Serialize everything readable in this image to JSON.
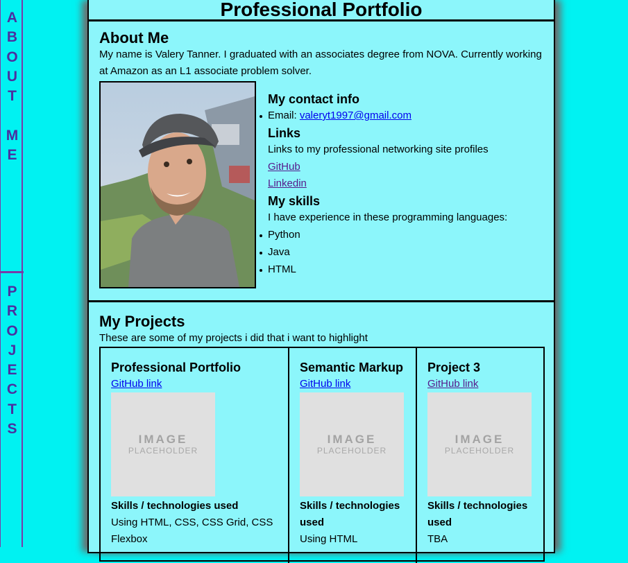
{
  "colors": {
    "background": "#00f2f2",
    "panel": "#8cf6fb",
    "nav_text": "#4b2fa0",
    "nav_border": "#7a3aa8",
    "link": "#0000ee",
    "visited_link": "#551a8b"
  },
  "sidenav": {
    "about_letters": [
      "A",
      "B",
      "O",
      "U",
      "T",
      "",
      "M",
      "E"
    ],
    "projects_letters": [
      "P",
      "R",
      "O",
      "J",
      "E",
      "C",
      "T",
      "S"
    ]
  },
  "site_title": "Professional Portfolio",
  "about": {
    "heading": "About Me",
    "text": "My name is Valery Tanner. I graduated with an associates degree from NOVA. Currently working at Amazon as an L1 associate problem solver.",
    "contact_heading": "My contact info",
    "email_label": "Email: ",
    "email": "valeryt1997@gmail.com",
    "links_heading": "Links",
    "links_intro": "Links to my professional networking site profiles",
    "github_link": "GitHub",
    "linkedin_link": "Linkedin",
    "skills_heading": "My skills",
    "skills_intro": "I have experience in these programming languages:",
    "skills": [
      "Python",
      "Java",
      "HTML"
    ]
  },
  "projects": {
    "heading": "My Projects",
    "intro": "These are some of my projects i did that i want to highlight",
    "items": [
      {
        "title": "Professional Portfolio",
        "link": "GitHub link",
        "placeholder_big": "IMAGE",
        "placeholder_small": "PLACEHOLDER",
        "skills_label": "Skills / technologies used",
        "skills_text": "Using HTML, CSS, CSS Grid, CSS Flexbox"
      },
      {
        "title": "Semantic Markup",
        "link": "GitHub link",
        "placeholder_big": "IMAGE",
        "placeholder_small": "PLACEHOLDER",
        "skills_label": "Skills / technologies used",
        "skills_text": "Using HTML"
      },
      {
        "title": "Project 3",
        "link": "GitHub link",
        "placeholder_big": "IMAGE",
        "placeholder_small": "PLACEHOLDER",
        "skills_label": "Skills / technologies used",
        "skills_text": "TBA"
      }
    ]
  }
}
